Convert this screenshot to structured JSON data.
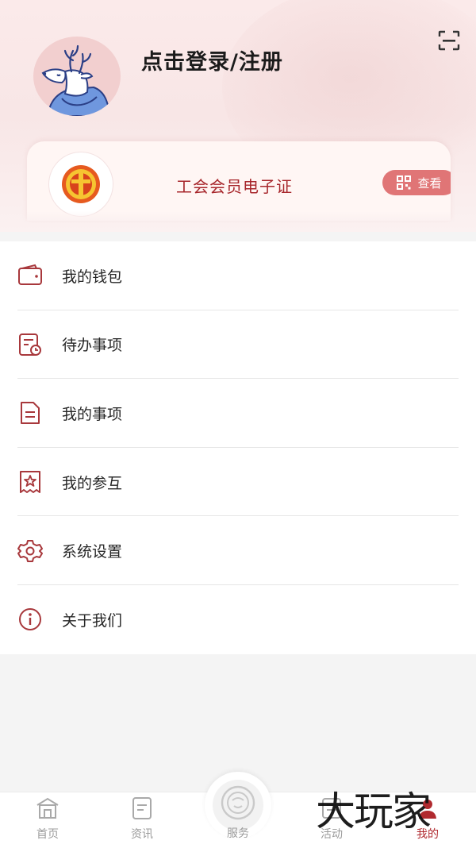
{
  "header": {
    "login_title": "点击登录/注册",
    "scan_icon": "scan-icon"
  },
  "member_card": {
    "title": "工会会员电子证",
    "view_label": "查看",
    "emblem_icon": "union-emblem-icon",
    "qr_icon": "qr-code-icon"
  },
  "menu": {
    "items": [
      {
        "label": "我的钱包",
        "icon": "wallet-icon"
      },
      {
        "label": "待办事项",
        "icon": "todo-icon"
      },
      {
        "label": "我的事项",
        "icon": "document-icon"
      },
      {
        "label": "我的参互",
        "icon": "star-ticket-icon"
      },
      {
        "label": "系统设置",
        "icon": "gear-icon"
      },
      {
        "label": "关于我们",
        "icon": "info-icon"
      }
    ]
  },
  "tabbar": {
    "tabs": [
      {
        "label": "首页",
        "icon": "home-icon"
      },
      {
        "label": "资讯",
        "icon": "news-icon"
      },
      {
        "label": "服务",
        "icon": "service-icon"
      },
      {
        "label": "活动",
        "icon": "activity-icon"
      },
      {
        "label": "我的",
        "icon": "profile-icon",
        "active": true
      }
    ]
  },
  "watermark": "大玩家",
  "colors": {
    "accent": "#b02a2f",
    "view_button": "#e07576",
    "icon_stroke": "#a8383c"
  }
}
